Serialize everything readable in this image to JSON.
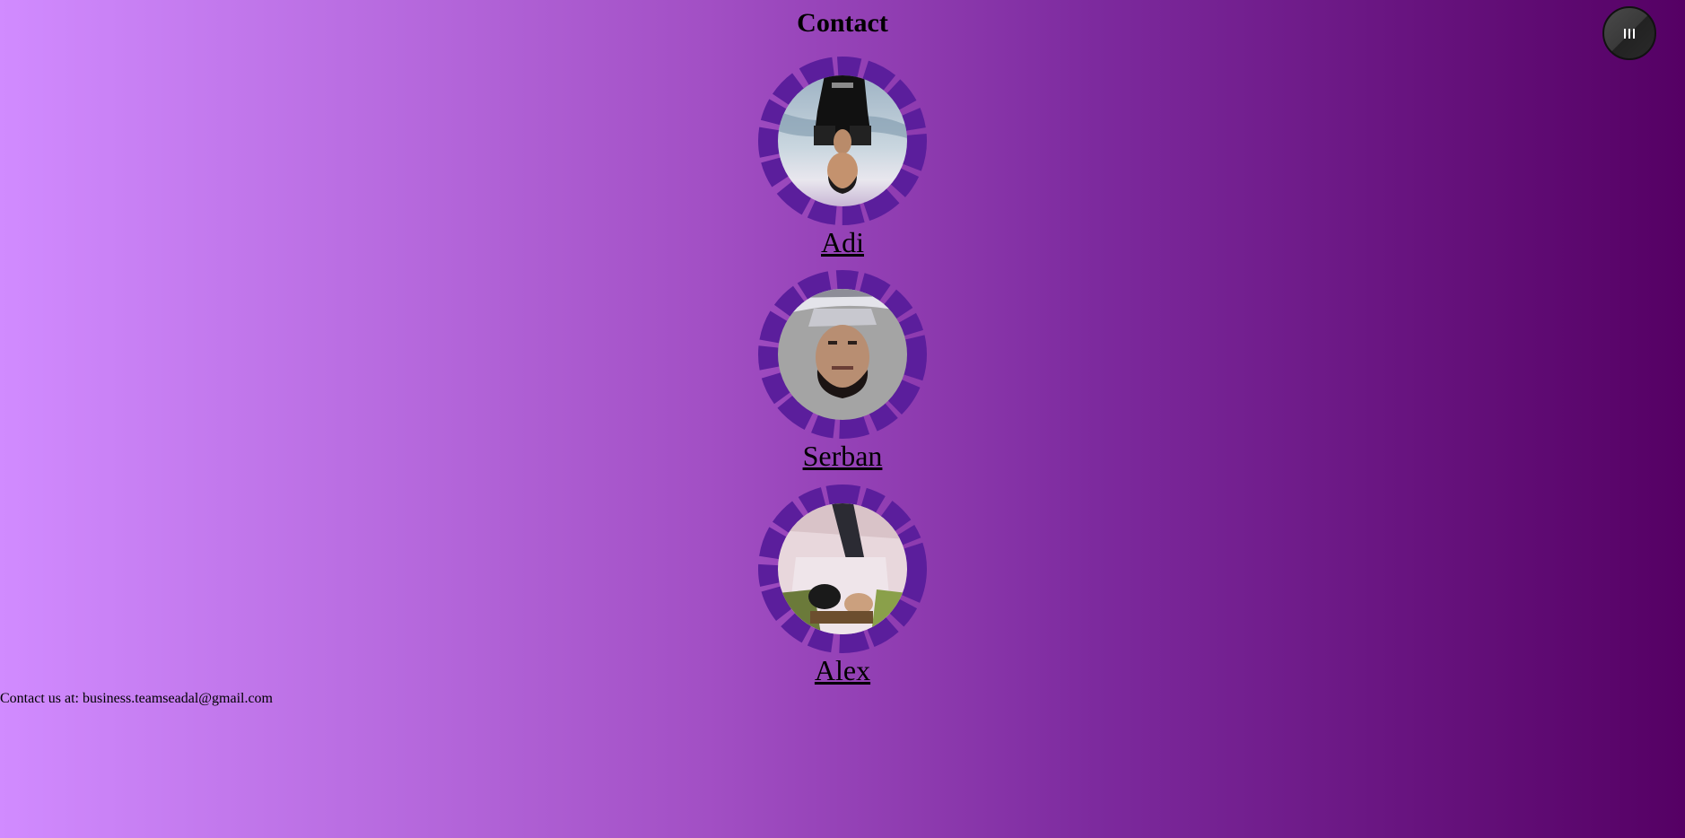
{
  "page": {
    "title": "Contact"
  },
  "menu": {
    "icon": "hamburger-icon",
    "colors": {
      "background": "#3a3a3a",
      "glyph": "#ffffff"
    }
  },
  "team": [
    {
      "name": "Adi"
    },
    {
      "name": "Serban"
    },
    {
      "name": "Alex"
    }
  ],
  "footer": {
    "contact_text": "Contact us at: business.teamseadal@gmail.com"
  },
  "colors": {
    "gradient_start": "#d18bff",
    "gradient_end": "#550064",
    "ring": "#5b1e9c"
  }
}
